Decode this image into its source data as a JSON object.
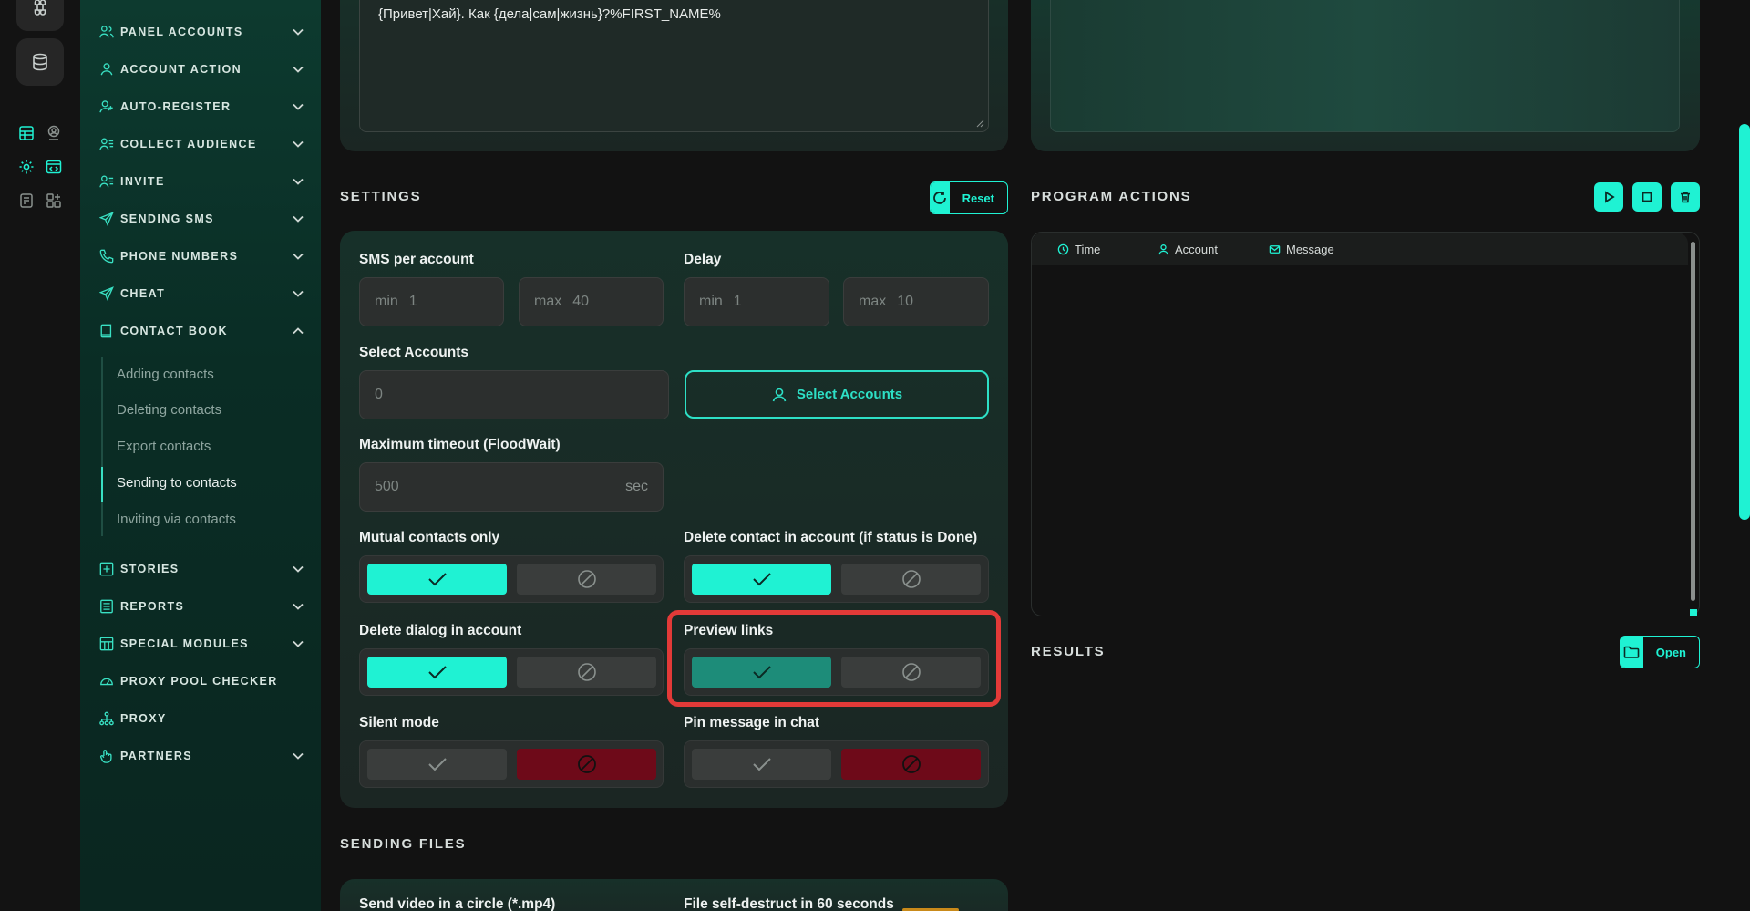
{
  "sidebar": {
    "items": [
      {
        "label": "PANEL ACCOUNTS",
        "icon": "users-icon",
        "chevron": "down"
      },
      {
        "label": "ACCOUNT ACTION",
        "icon": "user-icon",
        "chevron": "down"
      },
      {
        "label": "AUTO-REGISTER",
        "icon": "user-plus-icon",
        "chevron": "down"
      },
      {
        "label": "COLLECT AUDIENCE",
        "icon": "user-list-icon",
        "chevron": "down"
      },
      {
        "label": "INVITE",
        "icon": "user-list-icon",
        "chevron": "down"
      },
      {
        "label": "SENDING SMS",
        "icon": "paper-plane-icon",
        "chevron": "down"
      },
      {
        "label": "PHONE NUMBERS",
        "icon": "phone-icon",
        "chevron": "down"
      },
      {
        "label": "CHEAT",
        "icon": "paper-plane-icon",
        "chevron": "down"
      },
      {
        "label": "CONTACT BOOK",
        "icon": "book-icon",
        "chevron": "up"
      },
      {
        "label": "STORIES",
        "icon": "plus-square-icon",
        "chevron": "down"
      },
      {
        "label": "REPORTS",
        "icon": "report-icon",
        "chevron": "down"
      },
      {
        "label": "SPECIAL MODULES",
        "icon": "grid-icon",
        "chevron": "down"
      },
      {
        "label": "PROXY POOL CHECKER",
        "icon": "gauge-icon",
        "chevron": ""
      },
      {
        "label": "PROXY",
        "icon": "network-icon",
        "chevron": ""
      },
      {
        "label": "PARTNERS",
        "icon": "hand-icon",
        "chevron": "down"
      }
    ],
    "sub_items": [
      {
        "label": "Adding contacts"
      },
      {
        "label": "Deleting contacts"
      },
      {
        "label": "Export contacts"
      },
      {
        "label": "Sending to contacts"
      },
      {
        "label": "Inviting via contacts"
      }
    ]
  },
  "message": {
    "text": "{Привет|Хай}. Как {дела|сам|жизнь}?%FIRST_NAME%"
  },
  "settings": {
    "title": "SETTINGS",
    "reset_label": "Reset",
    "sms_per_account": {
      "label": "SMS per account",
      "min_ph": "min",
      "min_val": "1",
      "max_ph": "max",
      "max_val": "40"
    },
    "delay": {
      "label": "Delay",
      "min_ph": "min",
      "min_val": "1",
      "max_ph": "max",
      "max_val": "10"
    },
    "select_accounts": {
      "label": "Select Accounts",
      "value": "0",
      "button": "Select Accounts"
    },
    "timeout": {
      "label": "Maximum timeout (FloodWait)",
      "value": "500",
      "suffix": "sec"
    },
    "mutual": {
      "label": "Mutual contacts only"
    },
    "delete_contact": {
      "label": "Delete contact in account (if status is Done)"
    },
    "delete_dialog": {
      "label": "Delete dialog in account"
    },
    "preview_links": {
      "label": "Preview links"
    },
    "silent_mode": {
      "label": "Silent mode"
    },
    "pin_message": {
      "label": "Pin message in chat"
    }
  },
  "program_actions": {
    "title": "PROGRAM ACTIONS",
    "col_time": "Time",
    "col_account": "Account",
    "col_message": "Message"
  },
  "results": {
    "title": "RESULTS",
    "open_label": "Open"
  },
  "sending_files": {
    "title": "SENDING FILES",
    "video_label": "Send video in a circle (*.mp4)",
    "self_destruct_label": "File self-destruct in 60 seconds"
  },
  "colors": {
    "accent": "#1ff2d3",
    "danger": "#6e0a19",
    "highlight": "#e23a38"
  }
}
